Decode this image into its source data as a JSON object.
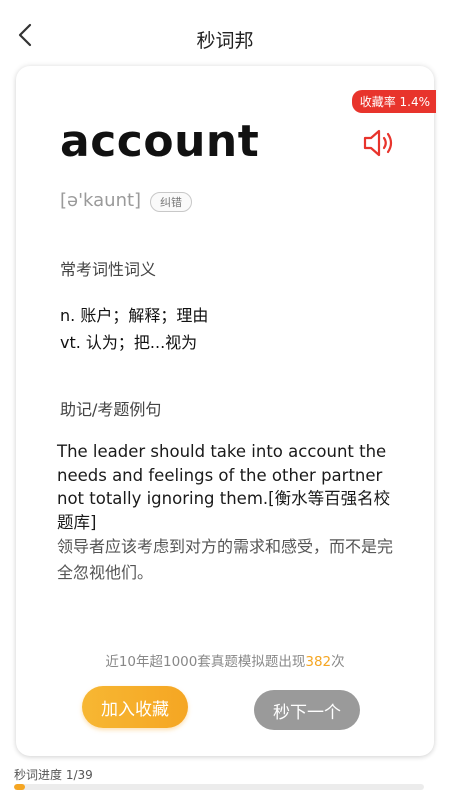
{
  "header": {
    "title": "秒词邦"
  },
  "card": {
    "favorite_rate": "收藏率 1.4%",
    "word": "account",
    "phonetic": "[ə'kaunt]",
    "correct_label": "纠错",
    "definitions_title": "常考词性词义",
    "definitions": [
      "n. 账户；解释；理由",
      "vt. 认为；把...视为"
    ],
    "example_title": "助记/考题例句",
    "example_en": "The leader should take into account the needs and feelings of the other partner not totally ignoring them.[衡水等百强名校题库]",
    "example_zh": "领导者应该考虑到对方的需求和感受，而不是完全忽视他们。",
    "frequency": {
      "prefix": "近10年超1000套真题模拟题出现",
      "count": "382",
      "suffix": "次"
    },
    "add_favorite_label": "加入收藏",
    "next_label": "秒下一个"
  },
  "progress": {
    "label": "秒词进度 1/39",
    "current": 1,
    "total": 39
  },
  "colors": {
    "accent": "#f5a623",
    "badge_red": "#e8342c",
    "speaker_red": "#e8342c",
    "next_button_gray": "#9a9a9a"
  },
  "icons": {
    "back": "chevron-left-icon",
    "speaker": "speaker-icon"
  }
}
